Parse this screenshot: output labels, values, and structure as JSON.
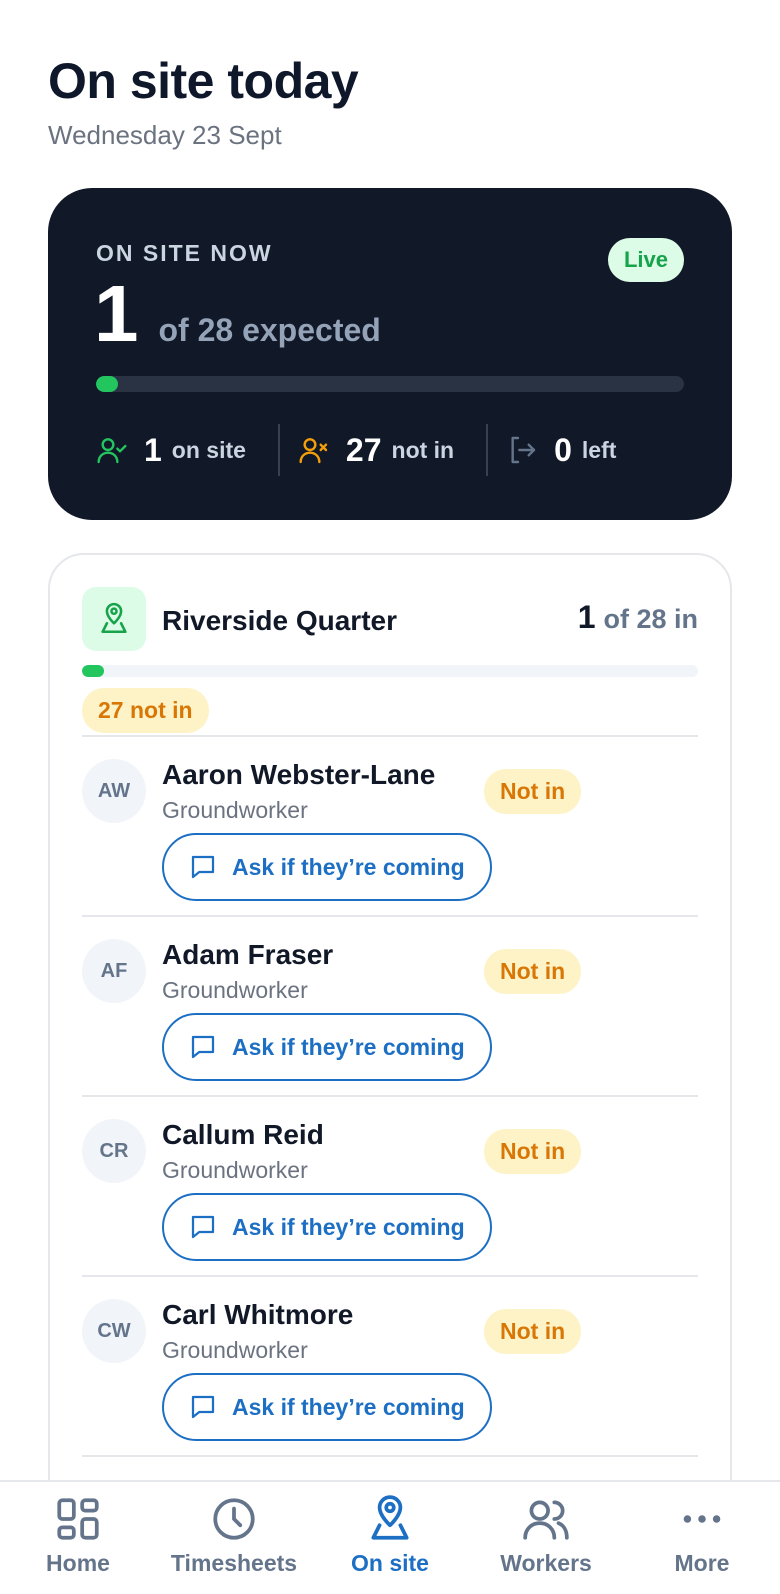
{
  "header": {
    "title": "On site today",
    "date": "Wednesday 23 Sept"
  },
  "summary": {
    "eyebrow": "ON SITE NOW",
    "live_label": "Live",
    "on_site_count": "1",
    "expected_text": "of 28 expected",
    "progress_fraction": 0.036,
    "stats": [
      {
        "value": "1",
        "label": "on site",
        "icon": "user-check-icon"
      },
      {
        "value": "27",
        "label": "not in",
        "icon": "user-x-icon"
      },
      {
        "value": "0",
        "label": "left",
        "icon": "log-out-icon"
      }
    ]
  },
  "site": {
    "name": "Riverside Quarter",
    "count_in": "1",
    "count_of": "of 28 in",
    "progress_fraction": 0.036,
    "not_in_chip": "27 not in",
    "workers": [
      {
        "initials": "AW",
        "name": "Aaron Webster-Lane",
        "role": "Groundworker",
        "status": "Not in",
        "action": "Ask if they’re coming"
      },
      {
        "initials": "AF",
        "name": "Adam Fraser",
        "role": "Groundworker",
        "status": "Not in",
        "action": "Ask if they’re coming"
      },
      {
        "initials": "CR",
        "name": "Callum Reid",
        "role": "Groundworker",
        "status": "Not in",
        "action": "Ask if they’re coming"
      },
      {
        "initials": "CW",
        "name": "Carl Whitmore",
        "role": "Groundworker",
        "status": "Not in",
        "action": "Ask if they’re coming"
      }
    ]
  },
  "nav": {
    "items": [
      {
        "label": "Home",
        "icon": "grid-icon",
        "active": false
      },
      {
        "label": "Timesheets",
        "icon": "clock-icon",
        "active": false
      },
      {
        "label": "On site",
        "icon": "map-pin-icon",
        "active": true
      },
      {
        "label": "Workers",
        "icon": "users-icon",
        "active": false
      },
      {
        "label": "More",
        "icon": "more-icon",
        "active": false
      }
    ]
  },
  "colors": {
    "accent": "#1d6fc4",
    "success": "#22c55e",
    "warning": "#d97706",
    "dark_card": "#111827"
  }
}
